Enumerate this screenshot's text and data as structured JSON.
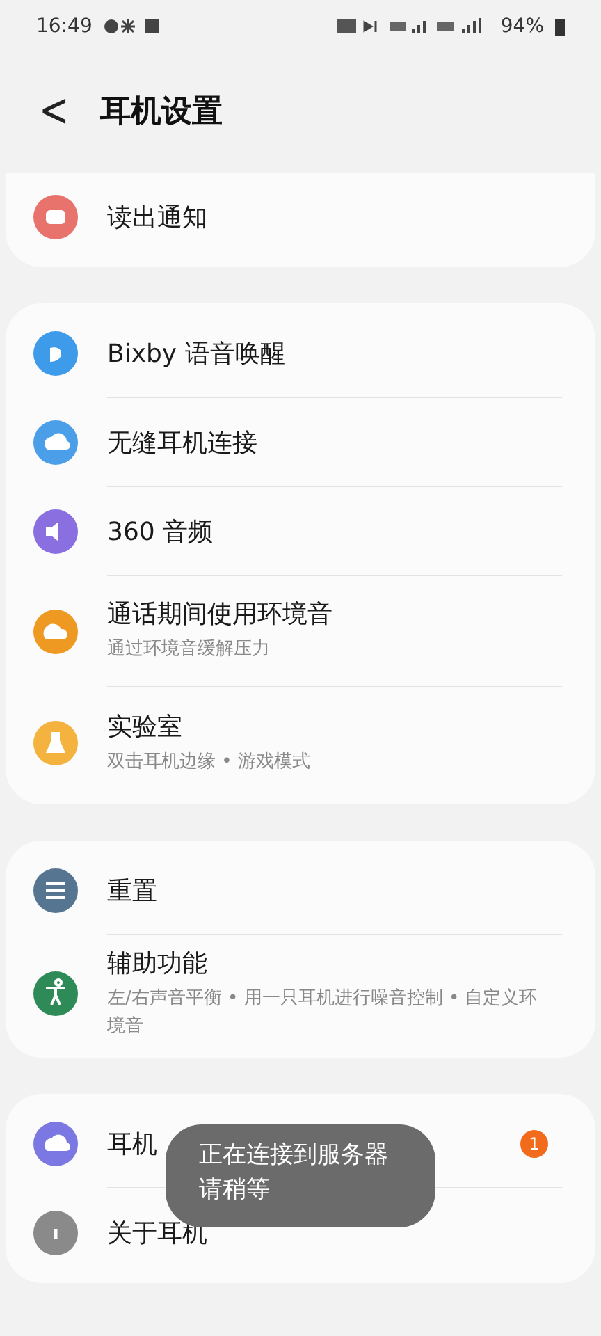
{
  "status_bar": {
    "time": "16:49",
    "battery": "94%"
  },
  "header": {
    "back": "<",
    "title": "耳机设置"
  },
  "groups": [
    {
      "items": [
        {
          "title": "读出通知",
          "color": "#e8736c"
        }
      ]
    },
    {
      "items": [
        {
          "title": "Bixby 语音唤醒",
          "color": "#3d9be9"
        },
        {
          "title": "无缝耳机连接",
          "color": "#4a9fe8"
        },
        {
          "title": "360 音频",
          "color": "#8a6fe0"
        },
        {
          "title": "通话期间使用环境音",
          "subtitle": "通过环境音缓解压力",
          "color": "#ee9a22"
        },
        {
          "title": "实验室",
          "subtitle": "双击耳机边缘 • 游戏模式",
          "color": "#f3b33e"
        }
      ]
    },
    {
      "items": [
        {
          "title": "重置",
          "color": "#567590"
        },
        {
          "title": "辅助功能",
          "subtitle": "左/右声音平衡 • 用一只耳机进行噪音控制 • 自定义环境音",
          "color": "#2e8b57"
        }
      ]
    },
    {
      "items": [
        {
          "title": "耳机",
          "color": "#7b78e4",
          "badge": "1"
        },
        {
          "title": "关于耳机",
          "color": "#8a8a8a"
        }
      ]
    }
  ],
  "toast": {
    "lines": [
      "正在连接到服务器",
      "请稍等"
    ]
  }
}
